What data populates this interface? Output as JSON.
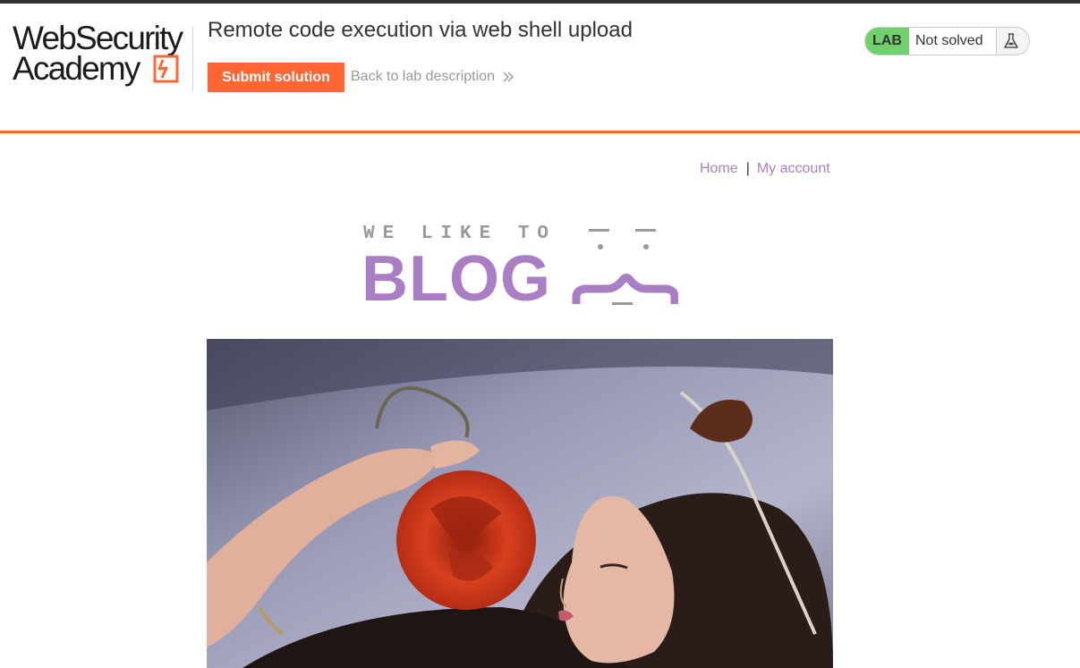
{
  "academy": {
    "logo_line1": "WebSecurity",
    "logo_line2": "Academy",
    "lab_title": "Remote code execution via web shell upload",
    "submit_label": "Submit solution",
    "back_label": "Back to lab description",
    "lab_badge": "LAB",
    "lab_status": "Not solved"
  },
  "nav": {
    "home": "Home",
    "separator": "|",
    "my_account": "My account"
  },
  "banner": {
    "kicker": "WE LIKE TO",
    "word": "BLOG"
  },
  "hero": {
    "icon": "post-image"
  },
  "colors": {
    "accent_orange": "#ff6633",
    "lab_green": "#70d16d",
    "blog_purple": "#a97ec4"
  }
}
